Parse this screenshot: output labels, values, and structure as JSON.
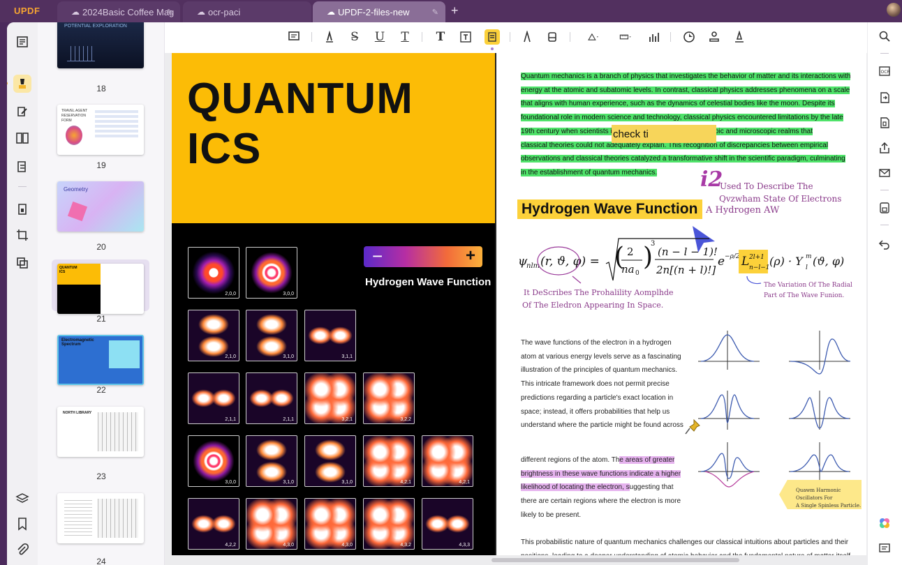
{
  "app": {
    "logo_a": "UPDF",
    "logo_b": ""
  },
  "tabs": [
    {
      "label": "2024Basic Coffee Mag",
      "active": false
    },
    {
      "label": "ocr-paci",
      "active": false
    },
    {
      "label": "UPDF-2-files-new",
      "active": true
    }
  ],
  "left_tools": [
    "reader-icon",
    "comment-icon",
    "edit-icon",
    "page-organize-icon",
    "form-icon",
    "protect-icon",
    "crop-icon",
    "compare-icon",
    "layers-icon",
    "bookmark-icon",
    "attachment-icon"
  ],
  "thumbnails": [
    {
      "page": "18",
      "title": "POTENTIAL EXPLORATION"
    },
    {
      "page": "19",
      "title": "TRAVEL AGENT RESERVATION FORM"
    },
    {
      "page": "20",
      "title": "Geometry"
    },
    {
      "page": "21",
      "title": "QUANTUM ICS"
    },
    {
      "page": "22",
      "title": "Electromagnetic Spectrum"
    },
    {
      "page": "23",
      "title": "NORTH LIBRARY"
    },
    {
      "page": "24",
      "title": ""
    }
  ],
  "toolbar_tools": [
    "note-icon",
    "highlighter-icon",
    "strikethrough-icon",
    "underline-icon",
    "squiggly-icon",
    "text-icon",
    "textbox-icon",
    "text-callout-icon",
    "pencil-icon",
    "eraser-icon",
    "shape-icon",
    "measure-icon",
    "chart-icon",
    "sticker-icon",
    "stamp-icon",
    "signature-icon"
  ],
  "page": {
    "title": "QUANTUM\nICS",
    "slider": {
      "minus": "−",
      "plus": "+"
    },
    "left_heading": "Hydrogen Wave Function",
    "orbitals": [
      [
        "2,0,0",
        "3,0,0"
      ],
      [
        "2,1,0",
        "3,1,0",
        "3,1,1"
      ],
      [
        "2,1,1",
        "2,1,1",
        "3,2,1",
        "3,2,2"
      ],
      [
        "3,0,0",
        "3,1,0",
        "3,1,0",
        "4,2,1",
        "4,2,1"
      ],
      [
        "4,2,2",
        "4,3,0",
        "4,3,0",
        "4,3,2",
        "4,3,3"
      ]
    ],
    "intro_lines": [
      "Quantum mechanics is a branch of physics that investigates the behavior of matter and its interactions with",
      "energy at the atomic and subatomic levels. In contrast, classical physics addresses phenomena on a scale",
      "that aligns with human experience, such as the dynamics of celestial bodies like the moon. Despite its",
      "foundational role in modern science and technology, classical physics encountered limitations by the late",
      "19th century when scientists identified phenomena at microscopic and microscopic realms that",
      "classical theories could not adequately explain. This recognition of discrepancies between empirical",
      "observations and classical theories catalyzed a transformative shift in the scientific paradigm, culminating",
      "in the establishment of quantum mechanics."
    ],
    "typed_annotation": "check ti",
    "i2": "i2",
    "hand_note_1": "Used To Describe The",
    "hand_note_2": "Qvzwham State Of Electrons",
    "hand_note_3": "A Hydrogen AW",
    "right_heading": "Hydrogen Wave Function",
    "hand_note_4": "It DeScribes The Prohalility Aomplhde",
    "hand_note_5": "Of The Eledron Appearing In Space.",
    "hand_note_6": "The Variation Of The Radial",
    "hand_note_7": "Part of The Wave Funion.",
    "body_lines": [
      "The wave functions of the electron in a hydrogen",
      "atom at various energy levels serve as a fascinating",
      "illustration of the principles of quantum mechanics.",
      "This intricate framework does not permit precise",
      "predictions regarding a particle's exact location in",
      "space; instead, it offers probabilities that help us",
      "understand where the particle might be found across"
    ],
    "body_hl_1a": "different regions of the atom. Th",
    "body_hl_1b": "e areas of greater",
    "body_hl_2": "brightness in these wave functions indicate a higher",
    "body_hl_3a": "likelihood of locating the electron, s",
    "body_hl_3b": "uggesting that",
    "body_tail_1": "there are certain regions where the electron is more",
    "body_tail_2": "likely to be present.",
    "sticky_1": "Quawm Harmonic Oscillators For",
    "sticky_2": "A Single Spinless Particle.",
    "closing_1": "This probabilistic nature of quantum mechanics challenges our classical intuitions about particles and their",
    "closing_2": "positions, leading to a deeper understanding of atomic behavior and the fundamental nature of matter itself."
  },
  "right_tools": [
    "search-icon",
    "ocr-icon",
    "convert-icon",
    "compress-icon",
    "share-icon",
    "mail-icon",
    "save-icon",
    "undo-icon",
    "ai-assistant-icon",
    "chat-icon"
  ]
}
